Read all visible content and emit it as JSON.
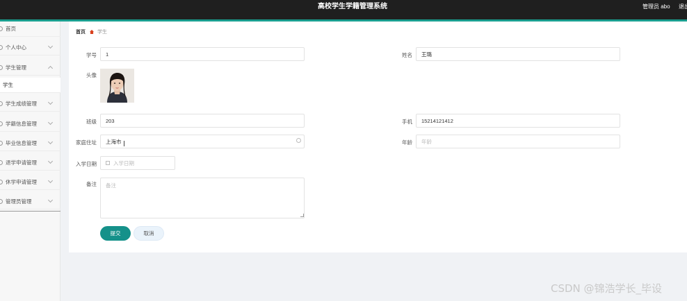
{
  "header": {
    "title": "高校学生学籍管理系统",
    "user": "管理员 abo",
    "logout": "退出"
  },
  "sidebar": {
    "items": [
      {
        "label": "首页"
      },
      {
        "label": "个人中心"
      },
      {
        "label": "学生管理"
      },
      {
        "label": "学生"
      },
      {
        "label": "学生成绩管理"
      },
      {
        "label": "学籍信息管理"
      },
      {
        "label": "毕业信息管理"
      },
      {
        "label": "退学申请管理"
      },
      {
        "label": "休学申请管理"
      },
      {
        "label": "管理员管理"
      }
    ]
  },
  "breadcrumb": {
    "home": "首页",
    "current": "学生"
  },
  "form": {
    "student_id": {
      "label": "学号",
      "value": "1"
    },
    "name": {
      "label": "姓名",
      "value": "王璐"
    },
    "avatar": {
      "label": "头像"
    },
    "class": {
      "label": "班级",
      "value": "203"
    },
    "phone": {
      "label": "手机",
      "value": "15214121412"
    },
    "address": {
      "label": "家庭住址",
      "value": "上海市"
    },
    "age": {
      "label": "年龄",
      "placeholder": "年龄"
    },
    "enroll_date": {
      "label": "入学日期",
      "placeholder": "入学日期"
    },
    "remark": {
      "label": "备注",
      "placeholder": "备注"
    }
  },
  "actions": {
    "submit": "提交",
    "cancel": "取消"
  },
  "watermark": "CSDN @锦浩学长_毕设",
  "colors": {
    "topbar": "#1f1f1f",
    "accent": "#1a9e8f",
    "submit": "#15918a",
    "breadcrumb_icon": "#d9411e"
  }
}
